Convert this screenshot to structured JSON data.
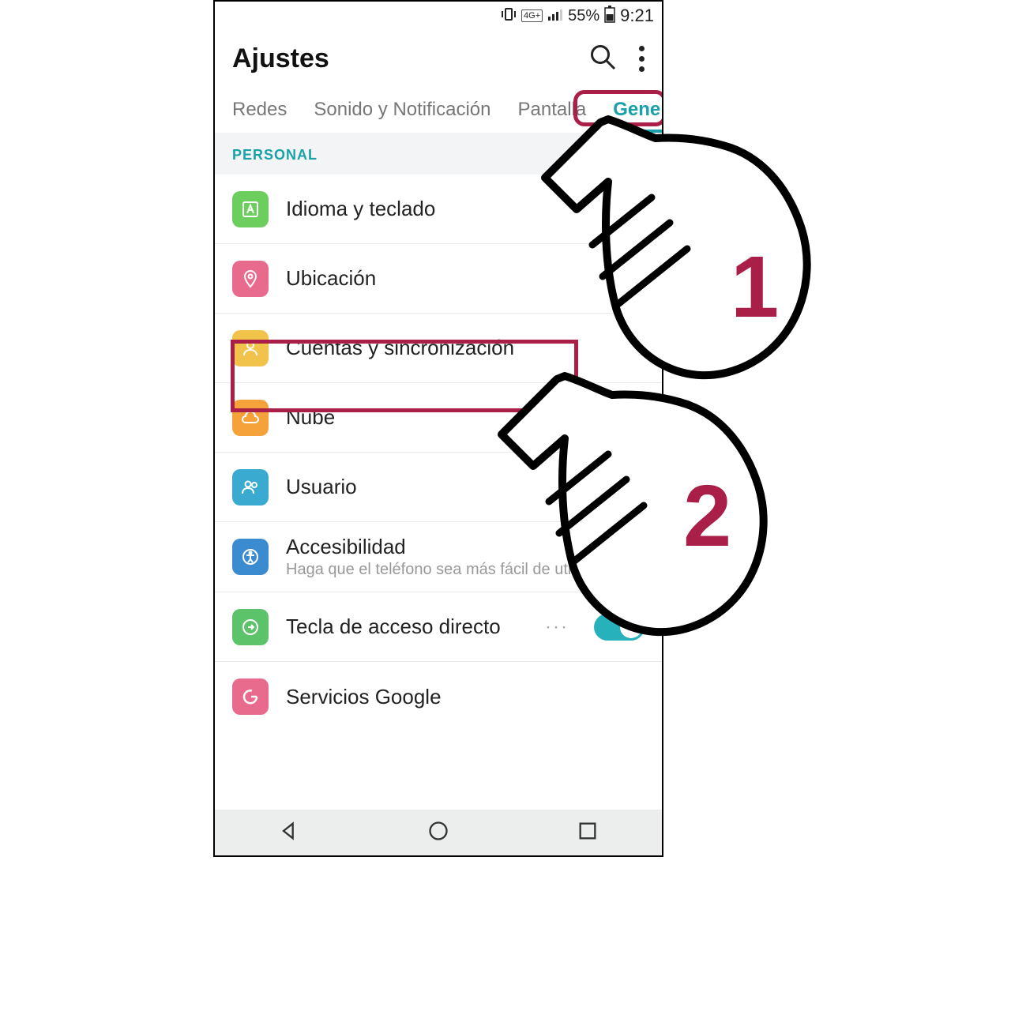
{
  "statusbar": {
    "battery": "55%",
    "time": "9:21",
    "network": "4G+"
  },
  "appbar": {
    "title": "Ajustes"
  },
  "tabs": {
    "networks": "Redes",
    "sound": "Sonido y Notificación",
    "display": "Pantalla",
    "general": "General",
    "active": "general"
  },
  "section": {
    "personal": "PERSONAL"
  },
  "list": {
    "language": {
      "label": "Idioma y teclado",
      "icon": "font",
      "color": "#6ccf5d"
    },
    "location": {
      "label": "Ubicación",
      "icon": "pin",
      "color": "#e86b8e"
    },
    "accounts": {
      "label": "Cuentas y sincronización",
      "icon": "user-sync",
      "color": "#f2c34a"
    },
    "cloud": {
      "label": "Nube",
      "icon": "cloud",
      "color": "#f5a23a"
    },
    "user": {
      "label": "Usuario",
      "icon": "users",
      "color": "#3baad0"
    },
    "accessibility": {
      "label": "Accesibilidad",
      "sub": "Haga que el teléfono sea más fácil de utilizar",
      "icon": "access",
      "color": "#3b8bd0"
    },
    "shortcut": {
      "label": "Tecla de acceso directo",
      "icon": "shortcut",
      "color": "#5cc36a",
      "dots": "···",
      "toggle": true
    },
    "google": {
      "label": "Servicios Google",
      "icon": "google",
      "color": "#e86b8e"
    }
  },
  "annotations": {
    "hand1": "1",
    "hand2": "2"
  }
}
